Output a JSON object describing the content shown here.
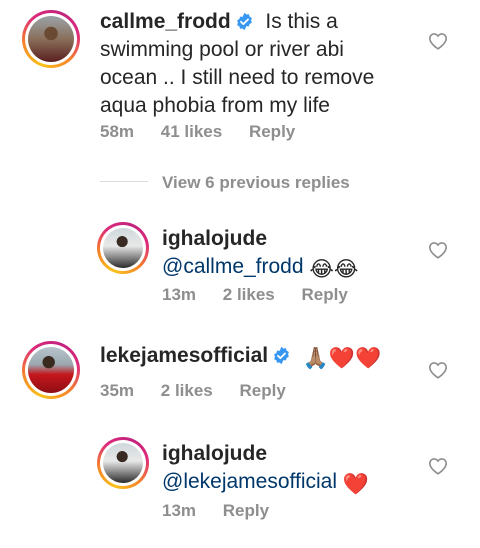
{
  "comments": [
    {
      "username": "callme_frodd",
      "verified": true,
      "text_lines": [
        "Is this a",
        "swimming pool or river abi",
        "ocean .. I still need to remove",
        "aqua phobia from my life"
      ],
      "time": "58m",
      "likes": "41 likes",
      "reply": "Reply"
    },
    {
      "username": "ighalojude",
      "mention": "@callme_frodd",
      "emoji": "😂😂",
      "time": "13m",
      "likes": "2 likes",
      "reply": "Reply"
    },
    {
      "username": "lekejamesofficial",
      "verified": true,
      "emoji": "🙏🏽❤️❤️",
      "time": "35m",
      "likes": "2 likes",
      "reply": "Reply"
    },
    {
      "username": "ighalojude",
      "mention": "@lekejamesofficial",
      "emoji": "❤️",
      "time": "13m",
      "reply": "Reply"
    }
  ],
  "view_replies": "View 6 previous replies",
  "icons": {
    "like": "heart-outline-icon",
    "verified": "verified-badge-icon"
  },
  "colors": {
    "verified": "#3897f0",
    "mention": "#00376b",
    "meta": "#8e8e8e",
    "heart": "#e0245e"
  }
}
